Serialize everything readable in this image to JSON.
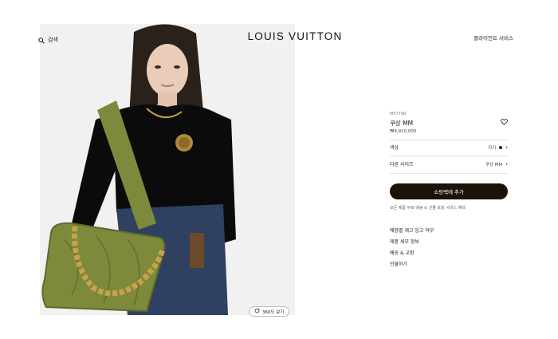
{
  "header": {
    "search_label": "검색",
    "logo": "LOUIS VUITTON",
    "client_service": "클라이언트 서비스"
  },
  "product": {
    "sku": "M57790",
    "name": "쿠상 MM",
    "price": "₩4,910,000"
  },
  "options": {
    "color_label": "색상",
    "color_value": "카키",
    "size_label": "다른 사이즈",
    "size_value": "쿠상 MM"
  },
  "cta": {
    "add_to_bag": "쇼핑백에 추가",
    "shipping_note": "모든 제품 무료 배송 & 선물 포장 서비스 혜택"
  },
  "links": [
    "매장별 재고 입고 여부",
    "제품 세부 정보",
    "배송 & 교환",
    "선물하기"
  ],
  "view360": "360도 보기",
  "colors": {
    "button": "#1b1208",
    "bag": "#7d8a3c",
    "chain": "#c9a24a"
  },
  "icons": [
    "search-icon",
    "heart-icon",
    "chevron-right-icon",
    "rotate-360-icon"
  ]
}
